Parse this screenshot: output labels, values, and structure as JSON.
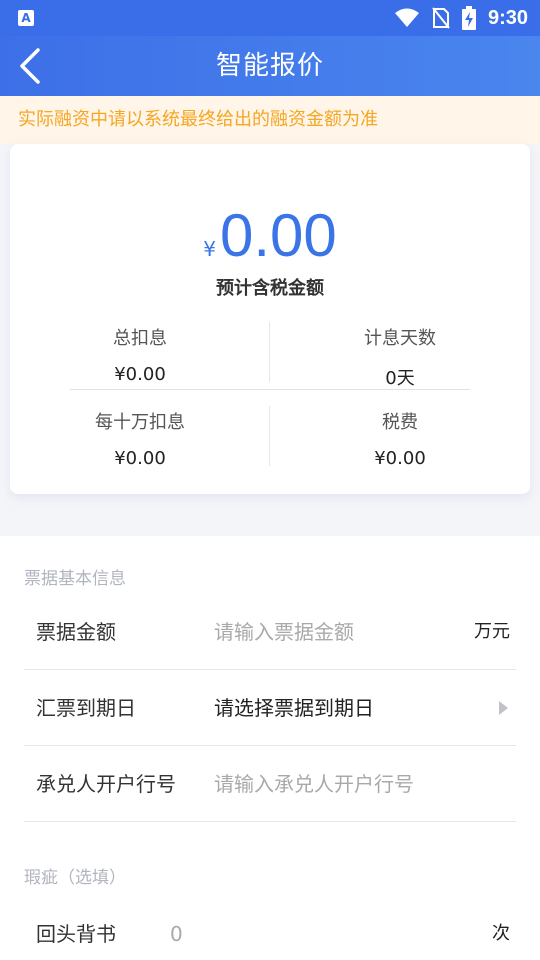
{
  "status_bar": {
    "app_icon_letter": "A",
    "time": "9:30"
  },
  "header": {
    "title": "智能报价"
  },
  "notice": {
    "text": "实际融资中请以系统最终给出的融资金额为准"
  },
  "quote": {
    "currency": "¥",
    "amount": "0.00",
    "amount_label": "预计含税金额",
    "stats": [
      {
        "title": "总扣息",
        "value": "¥0.00"
      },
      {
        "title": "计息天数",
        "value": "0天"
      },
      {
        "title": "每十万扣息",
        "value": "¥0.00"
      },
      {
        "title": "税费",
        "value": "¥0.00"
      }
    ]
  },
  "basic_info": {
    "section_title": "票据基本信息",
    "bill_amount": {
      "label": "票据金额",
      "placeholder": "请输入票据金额",
      "unit": "万元"
    },
    "due_date": {
      "label": "汇票到期日",
      "value": "请选择票据到期日"
    },
    "acceptor_bank": {
      "label": "承兑人开户行号",
      "placeholder": "请输入承兑人开户行号"
    }
  },
  "defects": {
    "section_title": "瑕疵（选填）",
    "endorsement_back": {
      "label": "回头背书",
      "placeholder": "0",
      "unit": "次"
    }
  },
  "colors": {
    "primary": "#3a6ee8",
    "notice_text": "#f5a623",
    "notice_bg": "#fff5e8",
    "amount": "#3a74e6"
  }
}
